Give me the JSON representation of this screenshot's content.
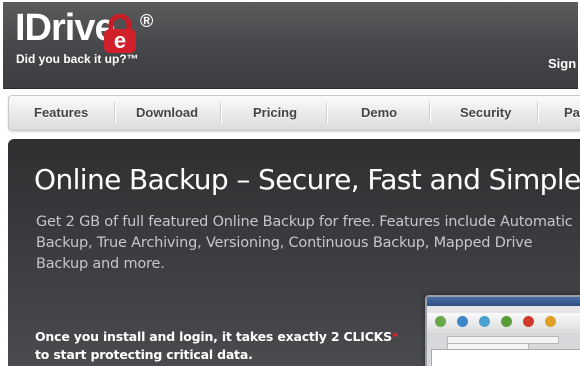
{
  "brand": {
    "name": "IDrive",
    "registered": "®",
    "tagline": "Did you back it up?™"
  },
  "header": {
    "signin_label": "Sign"
  },
  "nav": {
    "items": [
      {
        "label": "Features"
      },
      {
        "label": "Download"
      },
      {
        "label": "Pricing"
      },
      {
        "label": "Demo"
      },
      {
        "label": "Security"
      },
      {
        "label": "Pa"
      }
    ]
  },
  "hero": {
    "title": "Online Backup – Secure, Fast and Simple",
    "description": "Get 2 GB of full featured Online Backup for free. Features include Automatic Backup, True Archiving, Versioning, Continuous Backup, Mapped Drive Backup and more.",
    "cta_line1": "Once you install and login, it takes exactly 2 CLICKS",
    "cta_star": "*",
    "cta_line2": "to start protecting critical data."
  },
  "colors": {
    "header_bg": "#4a4b4e",
    "hero_bg": "#333436",
    "logo_red": "#d1202a",
    "accent_star": "#e3222a"
  },
  "icons": {
    "logo_lock": "padlock-icon"
  }
}
